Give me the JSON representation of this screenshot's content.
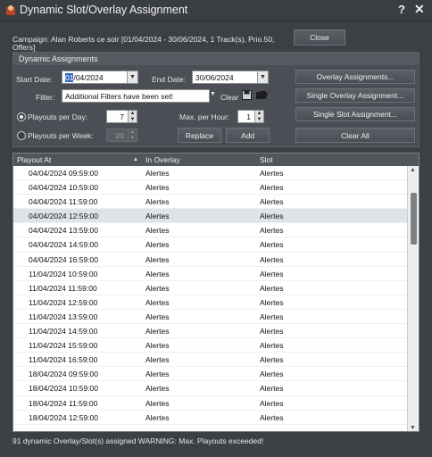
{
  "window": {
    "title": "Dynamic Slot/Overlay Assignment",
    "help_glyph": "?",
    "close_glyph": "✕"
  },
  "campaign": {
    "text": "Campaign: Alan Roberts ce soir [01/04/2024 - 30/06/2024, 1 Track(s), Prio.50, Offers]",
    "close_label": "Close"
  },
  "assignments": {
    "header": "Dynamic Assignments",
    "start_date_label": "Start Date:",
    "start_date_day": "01",
    "start_date_rest": "/04/2024",
    "end_date_label": "End Date:",
    "end_date": "30/06/2024",
    "filter_label": "Filter:",
    "filter_value": "Additional Filters have been set!",
    "clear_label": "Clear",
    "per_day_label": "Playouts per Day:",
    "per_day_value": "7",
    "per_week_label": "Playouts per Week:",
    "per_week_value": "20",
    "max_per_hour_label": "Max. per Hour:",
    "max_per_hour_value": "1",
    "replace_label": "Replace",
    "add_label": "Add",
    "overlay_assignments_label": "Overlay Assignments...",
    "single_overlay_label": "Single Overlay Assignment...",
    "single_slot_label": "Single Slot Assignment...",
    "clear_all_label": "Clear All",
    "selected_mode": "per_day"
  },
  "table": {
    "columns": [
      "Playout At",
      "In Overlay",
      "Slot"
    ],
    "sort_glyph": "▲",
    "rows": [
      [
        "04/04/2024 09:59:00",
        "Alertes",
        "Alertes"
      ],
      [
        "04/04/2024 10:59:00",
        "Alertes",
        "Alertes"
      ],
      [
        "04/04/2024 11:59:00",
        "Alertes",
        "Alertes"
      ],
      [
        "04/04/2024 12:59:00",
        "Alertes",
        "Alertes"
      ],
      [
        "04/04/2024 13:59:00",
        "Alertes",
        "Alertes"
      ],
      [
        "04/04/2024 14:59:00",
        "Alertes",
        "Alertes"
      ],
      [
        "04/04/2024 16:59:00",
        "Alertes",
        "Alertes"
      ],
      [
        "11/04/2024 10:59:00",
        "Alertes",
        "Alertes"
      ],
      [
        "11/04/2024 11:59:00",
        "Alertes",
        "Alertes"
      ],
      [
        "11/04/2024 12:59:00",
        "Alertes",
        "Alertes"
      ],
      [
        "11/04/2024 13:59:00",
        "Alertes",
        "Alertes"
      ],
      [
        "11/04/2024 14:59:00",
        "Alertes",
        "Alertes"
      ],
      [
        "11/04/2024 15:59:00",
        "Alertes",
        "Alertes"
      ],
      [
        "11/04/2024 16:59:00",
        "Alertes",
        "Alertes"
      ],
      [
        "18/04/2024 09:59:00",
        "Alertes",
        "Alertes"
      ],
      [
        "18/04/2024 10:59:00",
        "Alertes",
        "Alertes"
      ],
      [
        "18/04/2024 11:59:00",
        "Alertes",
        "Alertes"
      ],
      [
        "18/04/2024 12:59:00",
        "Alertes",
        "Alertes"
      ]
    ],
    "selected_row": 3
  },
  "status": {
    "text": "91 dynamic Overlay/Slot(s) assigned   WARNING: Max. Playouts exceeded!"
  },
  "colors": {
    "window_bg": "#3c3f44",
    "panel_bg": "#4b4e54",
    "selection": "#2f67c0"
  }
}
